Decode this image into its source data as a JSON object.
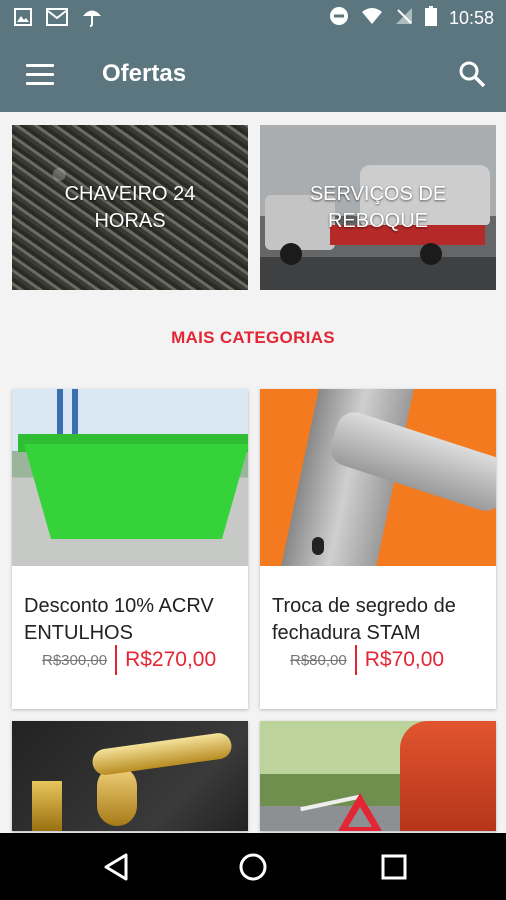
{
  "status_bar": {
    "time": "10:58",
    "left_icons": [
      "image-icon",
      "gmail-icon",
      "umbrella-icon"
    ],
    "right_icons": [
      "do-not-disturb-icon",
      "wifi-icon",
      "no-signal-icon",
      "battery-icon"
    ]
  },
  "app_bar": {
    "title": "Ofertas",
    "menu_icon": "menu-icon",
    "search_icon": "search-icon",
    "color": "#5c7680"
  },
  "categories": [
    {
      "label": "CHAVEIRO 24 HORAS"
    },
    {
      "label": "SERVIÇOS DE REBOQUE"
    }
  ],
  "more_categories": {
    "label": "MAIS CATEGORIAS",
    "color": "#e32636"
  },
  "offers": [
    {
      "title": "Desconto 10% ACRV ENTULHOS",
      "old_price": "R$300,00",
      "new_price": "R$270,00"
    },
    {
      "title": "Troca de segredo de fechadura STAM",
      "old_price": "R$80,00",
      "new_price": "R$70,00"
    },
    {
      "title": "",
      "old_price": "",
      "new_price": ""
    },
    {
      "title": "",
      "old_price": "",
      "new_price": ""
    }
  ],
  "nav_bar": {
    "icons": [
      "back-icon",
      "home-icon",
      "recent-apps-icon"
    ]
  }
}
